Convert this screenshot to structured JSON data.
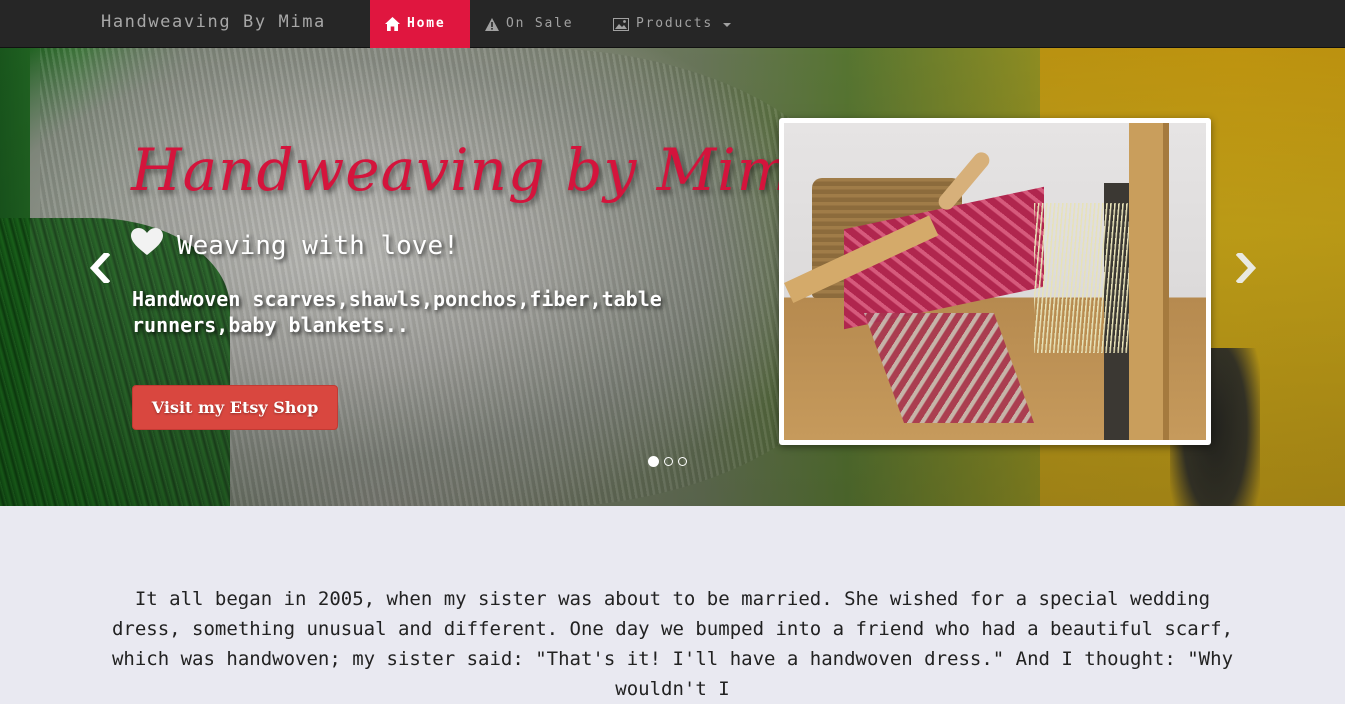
{
  "nav": {
    "brand": "Handweaving By Mima",
    "items": [
      {
        "label": "Home",
        "icon": "home-icon",
        "active": true
      },
      {
        "label": "On Sale",
        "icon": "warning-icon",
        "active": false
      },
      {
        "label": "Products",
        "icon": "picture-icon",
        "active": false,
        "dropdown": true
      }
    ]
  },
  "hero": {
    "title": "Handweaving by Mima",
    "subtitle": "Weaving with love!",
    "subtitle_icon": "heart-icon",
    "description": "Handwoven scarves,shawls,ponchos,fiber,table runners,baby blankets..",
    "cta_label": "Visit my Etsy Shop",
    "photo_alt": "loom-photo",
    "slides": 3,
    "active_slide": 1
  },
  "intro": {
    "text": "It all began in 2005, when my sister was about to be married. She wished for a special wedding dress, something unusual and different. One day we bumped into a friend who had a beautiful scarf, which was handwoven; my sister said: \"That's it! I'll have a handwoven dress.\" And I thought: \"Why wouldn't I"
  },
  "colors": {
    "navbar_bg": "#262626",
    "active_nav": "#e0163f",
    "hero_title": "#d4143c",
    "cta_bg": "#d9473f",
    "page_bg": "#e9e9f1"
  }
}
